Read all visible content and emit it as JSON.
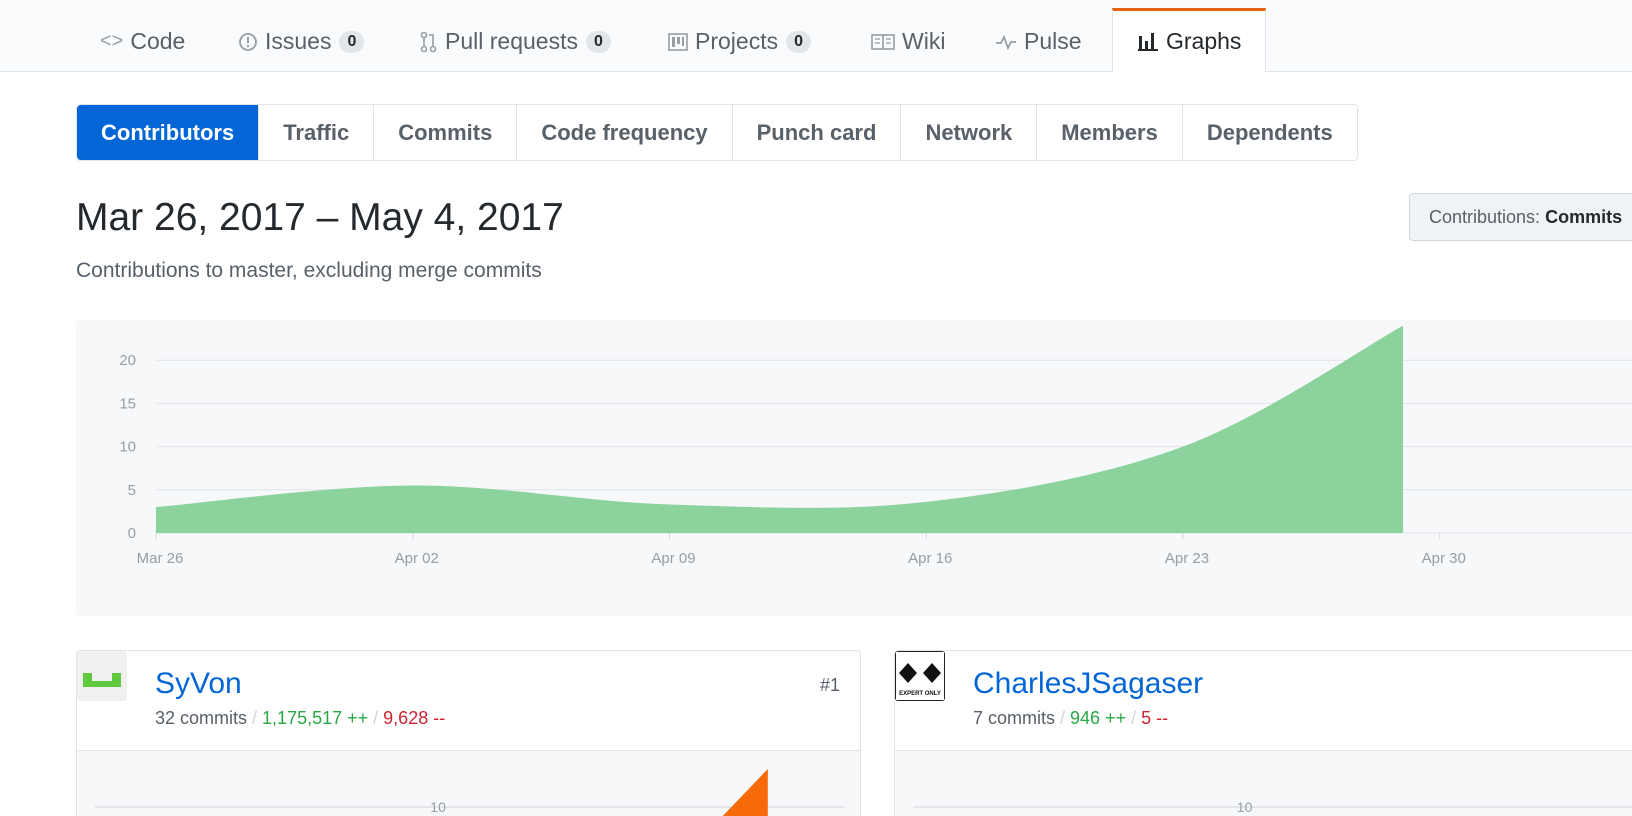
{
  "repo_nav": {
    "items": [
      {
        "icon": "code-icon",
        "label": "Code"
      },
      {
        "icon": "issue-icon",
        "label": "Issues",
        "count": "0"
      },
      {
        "icon": "pull-request-icon",
        "label": "Pull requests",
        "count": "0"
      },
      {
        "icon": "project-icon",
        "label": "Projects",
        "count": "0"
      },
      {
        "icon": "book-icon",
        "label": "Wiki"
      },
      {
        "icon": "pulse-icon",
        "label": "Pulse"
      },
      {
        "icon": "graph-icon",
        "label": "Graphs",
        "selected": true
      }
    ],
    "accent_color": "#e36209"
  },
  "subnav": {
    "items": [
      "Contributors",
      "Traffic",
      "Commits",
      "Code frequency",
      "Punch card",
      "Network",
      "Members",
      "Dependents"
    ],
    "selected": "Contributors",
    "selected_color": "#0366d6"
  },
  "header": {
    "range": "Mar 26, 2017 – May 4, 2017",
    "subtitle": "Contributions to master, excluding merge commits",
    "contributions_label": "Contributions:",
    "contributions_value": "Commits"
  },
  "chart_data": [
    {
      "type": "area",
      "x_tick_labels": [
        "Mar 26",
        "Apr 02",
        "Apr 09",
        "Apr 16",
        "Apr 23",
        "Apr 30"
      ],
      "y_ticks": [
        0,
        5,
        10,
        15,
        20
      ],
      "ylim": [
        0,
        20
      ],
      "grid": true,
      "color": "#8cd29c",
      "series": [
        {
          "x": [
            "Mar 26",
            "Apr 02",
            "Apr 09",
            "Apr 16",
            "Apr 23",
            "Apr 29"
          ],
          "values": [
            3,
            5.5,
            3.3,
            3.6,
            10,
            24
          ]
        }
      ]
    },
    {
      "type": "area",
      "y_ticks": [
        10
      ],
      "color": "#f66a0a",
      "series": [
        {
          "x": [
            "Apr 23",
            "Apr 29"
          ],
          "values": [
            10,
            16
          ]
        }
      ]
    },
    {
      "type": "area",
      "y_ticks": [
        10
      ],
      "color": "#f66a0a",
      "series": []
    }
  ],
  "contributors": [
    {
      "name": "SyVon",
      "commits": "32 commits",
      "additions": "1,175,517 ++",
      "deletions": "9,628 --",
      "rank": "#1",
      "avatar_color": "#5fca3d"
    },
    {
      "name": "CharlesJSagaser",
      "commits": "7 commits",
      "additions": "946 ++",
      "deletions": "5 --",
      "rank": "",
      "avatar_badge": "EXPERT ONLY"
    }
  ],
  "card_axis_label": "10"
}
